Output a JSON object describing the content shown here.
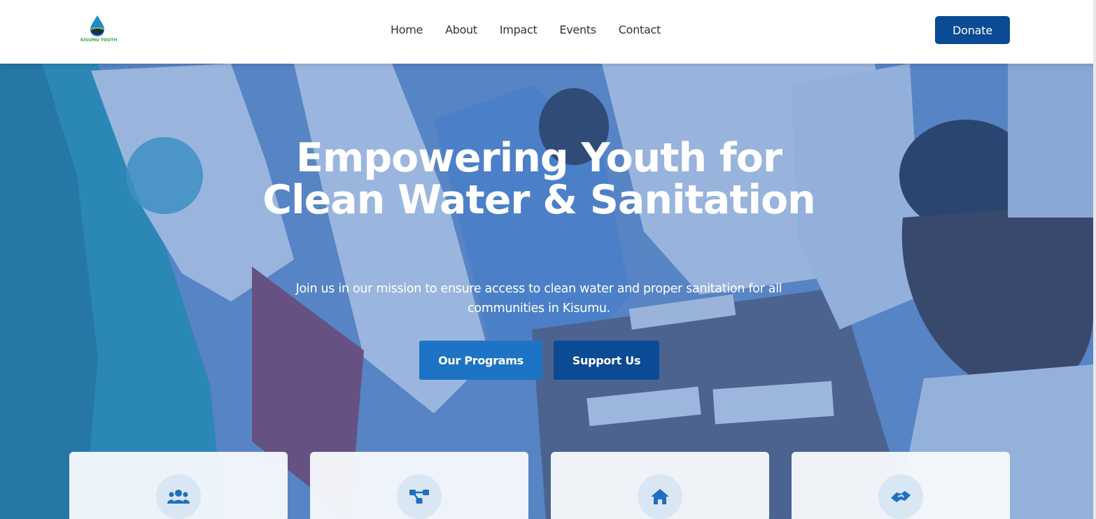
{
  "header": {
    "logo_text": "KISUMU YOUTH",
    "nav": [
      "Home",
      "About",
      "Impact",
      "Events",
      "Contact"
    ],
    "donate_label": "Donate"
  },
  "hero": {
    "title": "Empowering Youth for Clean Water & Sanitation",
    "subtitle": "Join us in our mission to ensure access to clean water and proper sanitation for all communities in Kisumu.",
    "primary_button": "Our Programs",
    "secondary_button": "Support Us"
  },
  "cards": [
    {
      "icon": "users-icon"
    },
    {
      "icon": "network-icon"
    },
    {
      "icon": "home-icon"
    },
    {
      "icon": "handshake-icon"
    }
  ],
  "colors": {
    "brand_dark": "#0b4a94",
    "brand_mid": "#1e74c4",
    "icon_circle": "#d9e6f3"
  }
}
